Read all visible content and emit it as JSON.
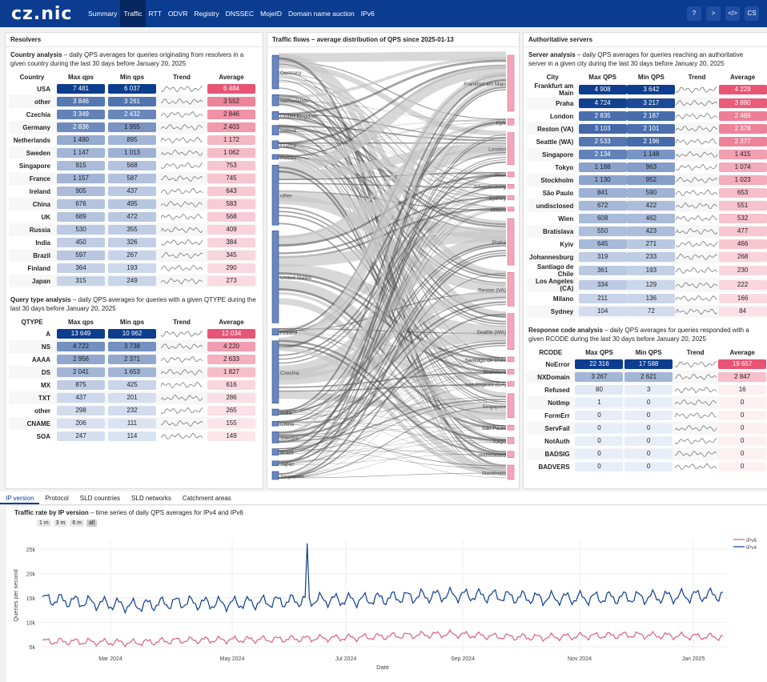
{
  "nav": {
    "logo": "cz.nic",
    "items": [
      "Summary",
      "Traffic",
      "RTT",
      "ODVR",
      "Registry",
      "DNSSEC",
      "MojeID",
      "Domain name auction",
      "IPv6"
    ],
    "active": "Traffic",
    "lang": "CS",
    "icons": [
      "help-icon",
      "terminal-icon",
      "code-icon"
    ]
  },
  "resolvers": {
    "title": "Resolvers",
    "country": {
      "desc_bold": "Country analysis",
      "desc": " – daily QPS averages for queries originating from resolvers in a given country during the last 30 days before January 20, 2025",
      "headers": [
        "Country",
        "Max qps",
        "Min qps",
        "Trend",
        "Average"
      ],
      "rows": [
        [
          "USA",
          "7 481",
          "6 037",
          "6 484"
        ],
        [
          "other",
          "3 846",
          "3 261",
          "3 552"
        ],
        [
          "Czechia",
          "3 349",
          "2 432",
          "2 846"
        ],
        [
          "Germany",
          "2 836",
          "1 955",
          "2 403"
        ],
        [
          "Netherlands",
          "1 490",
          "895",
          "1 172"
        ],
        [
          "Sweden",
          "1 147",
          "1 013",
          "1 062"
        ],
        [
          "Singapore",
          "915",
          "568",
          "753"
        ],
        [
          "France",
          "1 157",
          "587",
          "745"
        ],
        [
          "Ireland",
          "905",
          "437",
          "643"
        ],
        [
          "China",
          "676",
          "495",
          "583"
        ],
        [
          "UK",
          "689",
          "472",
          "568"
        ],
        [
          "Russia",
          "530",
          "355",
          "409"
        ],
        [
          "India",
          "450",
          "326",
          "384"
        ],
        [
          "Brazil",
          "597",
          "267",
          "345"
        ],
        [
          "Finland",
          "364",
          "193",
          "290"
        ],
        [
          "Japan",
          "315",
          "249",
          "273"
        ]
      ]
    },
    "qtype": {
      "desc_bold": "Query type analysis",
      "desc": " – daily QPS averages for queries with a given QTYPE during the last 30 days before January 20, 2025",
      "headers": [
        "QTYPE",
        "Max qps",
        "Min qps",
        "Trend",
        "Average"
      ],
      "rows": [
        [
          "A",
          "13 649",
          "10 962",
          "12 034"
        ],
        [
          "NS",
          "4 722",
          "3 738",
          "4 220"
        ],
        [
          "AAAA",
          "2 956",
          "2 371",
          "2 633"
        ],
        [
          "DS",
          "2 041",
          "1 653",
          "1 827"
        ],
        [
          "MX",
          "875",
          "425",
          "616"
        ],
        [
          "TXT",
          "437",
          "201",
          "286"
        ],
        [
          "other",
          "298",
          "232",
          "265"
        ],
        [
          "CNAME",
          "206",
          "111",
          "155"
        ],
        [
          "SOA",
          "247",
          "114",
          "149"
        ]
      ]
    }
  },
  "flows": {
    "title": "Traffic flows – average distribution of QPS since 2025-01-13",
    "left": [
      "Germany",
      "Netherlands",
      "United Kingdom",
      "Ireland",
      "France",
      "Russia",
      "other",
      "United States",
      "Finland",
      "Czechia",
      "India",
      "China",
      "Sweden",
      "Brazil",
      "Japan",
      "Singapore"
    ],
    "right": [
      "Frankfurt am Main",
      "Kyiv",
      "London",
      "Wien",
      "Johannesburg",
      "Sydney",
      "Milano",
      "Praha",
      "Reston (VA)",
      "Seattle (WA)",
      "Santiago de Chile",
      "Bratislava",
      "Los Angeles (CA)",
      "Singapore",
      "São Paulo",
      "Tokyo",
      "undisclosed",
      "Stockholm"
    ]
  },
  "auth": {
    "title": "Authoritative servers",
    "server": {
      "desc_bold": "Server analysis",
      "desc": " – daily QPS averages for queries reaching an authoritative server in a given city during the last 30 days before January 20, 2025",
      "headers": [
        "City",
        "Max QPS",
        "Min QPS",
        "Trend",
        "Average"
      ],
      "rows": [
        [
          "Frankfurt am Main",
          "4 908",
          "3 642",
          "4 229"
        ],
        [
          "Praha",
          "4 724",
          "3 217",
          "3 880"
        ],
        [
          "London",
          "2 835",
          "2 187",
          "2 489"
        ],
        [
          "Reston (VA)",
          "3 103",
          "2 101",
          "2 378"
        ],
        [
          "Seattle (WA)",
          "2 533",
          "2 196",
          "2 377"
        ],
        [
          "Singapore",
          "2 134",
          "1 148",
          "1 415"
        ],
        [
          "Tokyo",
          "1 188",
          "963",
          "1 074"
        ],
        [
          "Stockholm",
          "1 130",
          "952",
          "1 023"
        ],
        [
          "São Paulo",
          "841",
          "590",
          "653"
        ],
        [
          "undisclosed",
          "672",
          "422",
          "551"
        ],
        [
          "Wien",
          "608",
          "462",
          "532"
        ],
        [
          "Bratislava",
          "550",
          "423",
          "477"
        ],
        [
          "Kyiv",
          "645",
          "271",
          "466"
        ],
        [
          "Johannesburg",
          "319",
          "233",
          "268"
        ],
        [
          "Santiago de Chile",
          "361",
          "193",
          "230"
        ],
        [
          "Los Angeles (CA)",
          "334",
          "129",
          "222"
        ],
        [
          "Milano",
          "211",
          "136",
          "166"
        ],
        [
          "Sydney",
          "104",
          "72",
          "84"
        ]
      ]
    },
    "rcode": {
      "desc_bold": "Response code analysis",
      "desc": " – daily QPS averages for queries responded with a given RCODE during the last 30 days before January 20, 2025",
      "headers": [
        "RCODE",
        "Max QPS",
        "Min QPS",
        "Trend",
        "Average"
      ],
      "rows": [
        [
          "NoError",
          "22 316",
          "17 588",
          "19 657"
        ],
        [
          "NXDomain",
          "3 267",
          "2 621",
          "2 847"
        ],
        [
          "Refused",
          "80",
          "3",
          "16"
        ],
        [
          "NotImp",
          "1",
          "0",
          "0"
        ],
        [
          "FormErr",
          "0",
          "0",
          "0"
        ],
        [
          "ServFail",
          "0",
          "0",
          "0"
        ],
        [
          "NotAuth",
          "0",
          "0",
          "0"
        ],
        [
          "BADSIG",
          "0",
          "0",
          "0"
        ],
        [
          "BADVERS",
          "0",
          "0",
          "0"
        ]
      ]
    }
  },
  "tabs": [
    "IP version",
    "Protocol",
    "SLD countries",
    "SLD networks",
    "Catchment areas"
  ],
  "active_tab": "IP version",
  "ipchart": {
    "desc_bold": "Traffic rate by IP version",
    "desc": " – time series of daily QPS averages for IPv4 and IPv6",
    "ranges": [
      "1 m",
      "3 m",
      "6 m",
      "all"
    ],
    "active_range": "all"
  },
  "chart_data": {
    "type": "line",
    "xlabel": "Date",
    "ylabel": "Queries per second",
    "xticks": [
      "Mar 2024",
      "May 2024",
      "Jul 2024",
      "Sep 2024",
      "Nov 2024",
      "Jan 2025"
    ],
    "yticks": [
      "5k",
      "10k",
      "15k",
      "20k",
      "25k"
    ],
    "ylim": [
      4000,
      27000
    ],
    "legend": "top-right",
    "series": [
      {
        "name": "IPv6",
        "color": "#d9607e",
        "approx": [
          6100,
          6000,
          5800,
          6300,
          6400,
          6500,
          6700,
          6900,
          7300,
          7600,
          7100,
          6900,
          7200,
          7400,
          7200,
          7000
        ]
      },
      {
        "name": "IPv4",
        "color": "#0d3d8f",
        "approx": [
          14800,
          14100,
          13400,
          14100,
          13800,
          14200,
          14600,
          14600,
          15200,
          15600,
          15400,
          14900,
          15000,
          15100,
          15300,
          15700
        ]
      }
    ],
    "spike": {
      "date": "Jun 2024",
      "value": 26200
    }
  },
  "colors": {
    "brand": "#0b3c8f",
    "max_dark": "#0d3d8f",
    "avg_pink": "#e85474"
  }
}
